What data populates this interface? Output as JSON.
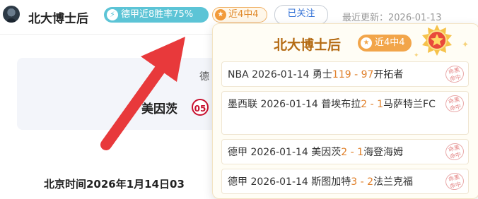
{
  "header": {
    "name": "北大博士后",
    "win_rate_badge": "德甲近8胜率75%",
    "streak_badge": "近4中4",
    "follow_button": "已关注",
    "update_label": "最近更新：2026-01-13"
  },
  "background": {
    "league_fragment": "德",
    "home_team": "美因茨",
    "beijing_time": "北京时间2026年1月14日03"
  },
  "popup": {
    "title": "北大博士后",
    "streak_badge": "近4中4",
    "stamp_text": "命黑\n命中",
    "records": [
      {
        "prefix": "NBA 2026-01-14 勇士",
        "score_home": "119",
        "dash": " - ",
        "score_away": "97",
        "away": "开拓者"
      },
      {
        "prefix": "墨西联 2026-01-14 普埃布拉",
        "score_home": "2",
        "dash": " - ",
        "score_away": "1",
        "away": "马萨特兰FC"
      },
      {
        "prefix": "德甲 2026-01-14 美因茨",
        "score_home": "2",
        "dash": " - ",
        "score_away": "1",
        "away": "海登海姆"
      },
      {
        "prefix": "德甲 2026-01-14 斯图加特",
        "score_home": "3",
        "dash": " - ",
        "score_away": "2",
        "away": "法兰克福"
      }
    ]
  },
  "colors": {
    "accent_teal": "#5cc4d6",
    "accent_orange": "#f2a54a",
    "score_orange": "#e0802b",
    "arrow_red": "#e8393b",
    "link_blue": "#2f6fd6"
  },
  "icons": {
    "rate_badge_icon": "bolt-icon",
    "streak_badge_icon": "star-icon",
    "medal_icon": "medal-star-icon",
    "stamp_icon": "hit-stamp-icon"
  }
}
